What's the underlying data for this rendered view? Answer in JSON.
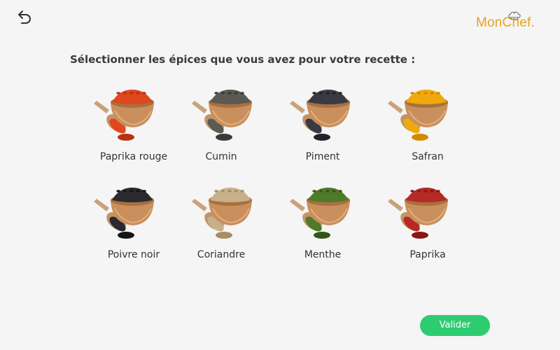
{
  "header": {
    "logo_text": "MonChef."
  },
  "page": {
    "heading": "Sélectionner les épices que vous avez pour votre recette :"
  },
  "spices": [
    {
      "label": "Paprika rouge",
      "color": "#e0471c",
      "dark": "#b8330f"
    },
    {
      "label": "Cumin",
      "color": "#5a5a52",
      "dark": "#3b3b35"
    },
    {
      "label": "Piment",
      "color": "#3a3a44",
      "dark": "#22222a"
    },
    {
      "label": "Safran",
      "color": "#f0a90c",
      "dark": "#d08a00"
    },
    {
      "label": "Poivre noir",
      "color": "#2a2a30",
      "dark": "#141418"
    },
    {
      "label": "Coriandre",
      "color": "#c9b08a",
      "dark": "#a68d66"
    },
    {
      "label": "Menthe",
      "color": "#4e7a2a",
      "dark": "#33561a"
    },
    {
      "label": "Paprika",
      "color": "#b52a22",
      "dark": "#851812"
    }
  ],
  "actions": {
    "validate_label": "Valider"
  },
  "colors": {
    "accent": "#2ecc71",
    "brand": "#e8a21e"
  }
}
